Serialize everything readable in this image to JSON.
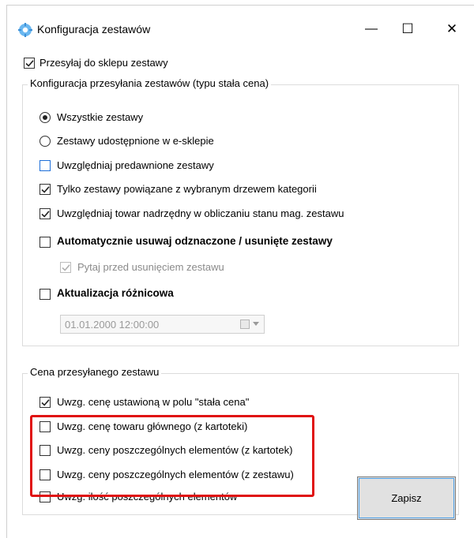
{
  "window": {
    "title": "Konfiguracja zestawów",
    "minimize_glyph": "—",
    "maximize_glyph": "☐",
    "close_glyph": "✕",
    "icon": "gear-icon",
    "accent_color": "#4da0e8"
  },
  "main_checkbox": {
    "label": "Przesyłaj do sklepu zestawy",
    "checked": true
  },
  "group_config": {
    "title": "Konfiguracja przesyłania zestawów (typu stała cena)",
    "radio_all": {
      "label": "Wszystkie zestawy",
      "selected": true
    },
    "radio_shared": {
      "label": "Zestawy udostępnione w e-sklepie",
      "selected": false
    },
    "cb_predefined": {
      "label": "Uwzględniaj predawnione zestawy",
      "checked": false
    },
    "cb_category": {
      "label": "Tylko zestawy powiązane z wybranym drzewem kategorii",
      "checked": true
    },
    "cb_parent": {
      "label": "Uwzględniaj towar nadrzędny w obliczaniu stanu mag. zestawu",
      "checked": true
    },
    "cb_autodelete": {
      "label": "Automatycznie usuwaj odznaczone / usunięte zestawy",
      "checked": false
    },
    "cb_ask": {
      "label": "Pytaj przed usunięciem zestawu",
      "checked": true,
      "enabled": false
    },
    "cb_diff": {
      "label": "Aktualizacja różnicowa",
      "checked": false
    },
    "date_value": "01.01.2000 12:00:00"
  },
  "group_price": {
    "title": "Cena przesyłanego zestawu",
    "cb_fixed": {
      "label": "Uwzg. cenę ustawioną w polu \"stała cena\"",
      "checked": true
    },
    "cb_main": {
      "label": "Uwzg. cenę towaru głównego (z kartoteki)",
      "checked": false
    },
    "cb_elements_card": {
      "label": "Uwzg. ceny poszczególnych elementów (z kartotek)",
      "checked": false
    },
    "cb_elements_set": {
      "label": "Uwzg. ceny poszczególnych elementów (z zestawu)",
      "checked": false
    },
    "cb_quantity": {
      "label": "Uwzg. ilość poszczególnych elementów",
      "checked": false
    }
  },
  "save_button": {
    "label": "Zapisz"
  },
  "highlight_color": "#e01010"
}
